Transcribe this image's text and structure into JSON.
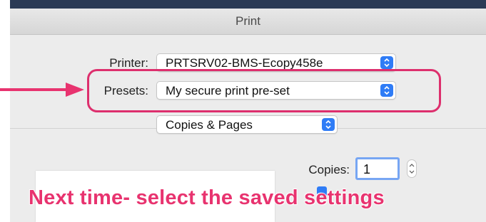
{
  "window": {
    "title": "Print"
  },
  "printer": {
    "label": "Printer:",
    "value": "PRTSRV02-BMS-Ecopy458e"
  },
  "presets": {
    "label": "Presets:",
    "value": "My secure print pre-set"
  },
  "section": {
    "value": "Copies & Pages"
  },
  "copies": {
    "label": "Copies:",
    "value": "1"
  },
  "annotation": {
    "caption": "Next time- select the saved settings",
    "color": "#dd2f6d"
  },
  "icons": [
    "chevron-updown-icon",
    "arrow-icon",
    "stepper-icon"
  ]
}
